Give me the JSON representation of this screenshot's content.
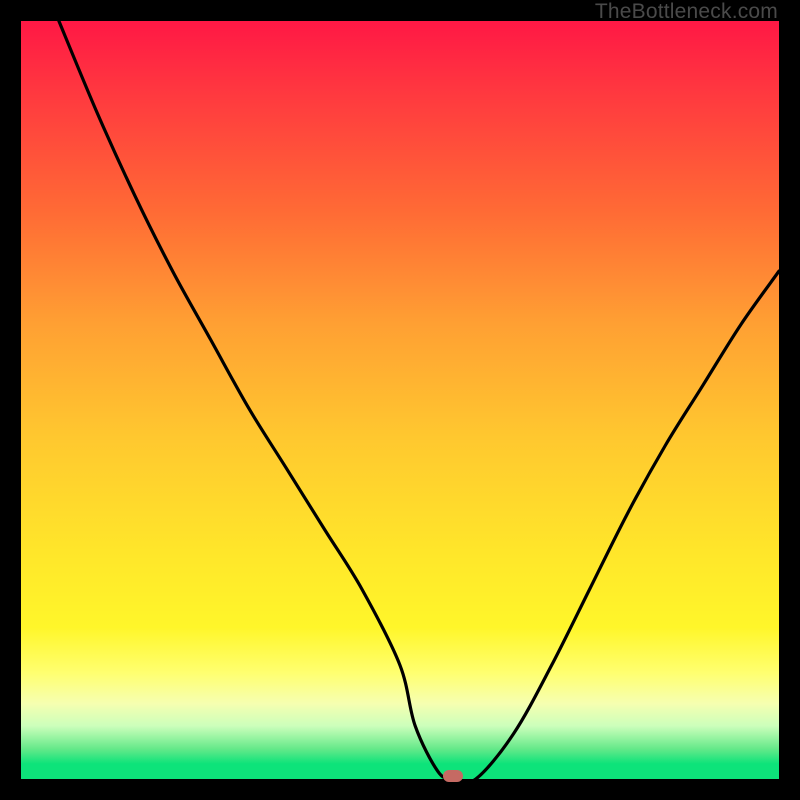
{
  "watermark": "TheBottleneck.com",
  "colors": {
    "frame_bg": "#000000",
    "marker_fill": "#c56a63",
    "curve_stroke": "#000000"
  },
  "chart_data": {
    "type": "line",
    "title": "",
    "xlabel": "",
    "ylabel": "",
    "xlim": [
      0,
      100
    ],
    "ylim": [
      0,
      100
    ],
    "grid": false,
    "legend": false,
    "series": [
      {
        "name": "bottleneck-curve",
        "x": [
          5,
          10,
          15,
          20,
          25,
          30,
          35,
          40,
          45,
          50,
          52,
          55,
          57,
          60,
          65,
          70,
          75,
          80,
          85,
          90,
          95,
          100
        ],
        "y": [
          100,
          88,
          77,
          67,
          58,
          49,
          41,
          33,
          25,
          15,
          7,
          1,
          0,
          0,
          6,
          15,
          25,
          35,
          44,
          52,
          60,
          67
        ]
      }
    ],
    "marker": {
      "x": 57,
      "y": 0
    },
    "gradient_stops": [
      {
        "pos": 0,
        "color": "#ff1845"
      },
      {
        "pos": 25,
        "color": "#ff6a35"
      },
      {
        "pos": 55,
        "color": "#ffc82f"
      },
      {
        "pos": 80,
        "color": "#fff62a"
      },
      {
        "pos": 93,
        "color": "#ccffbb"
      },
      {
        "pos": 100,
        "color": "#0de37a"
      }
    ]
  }
}
